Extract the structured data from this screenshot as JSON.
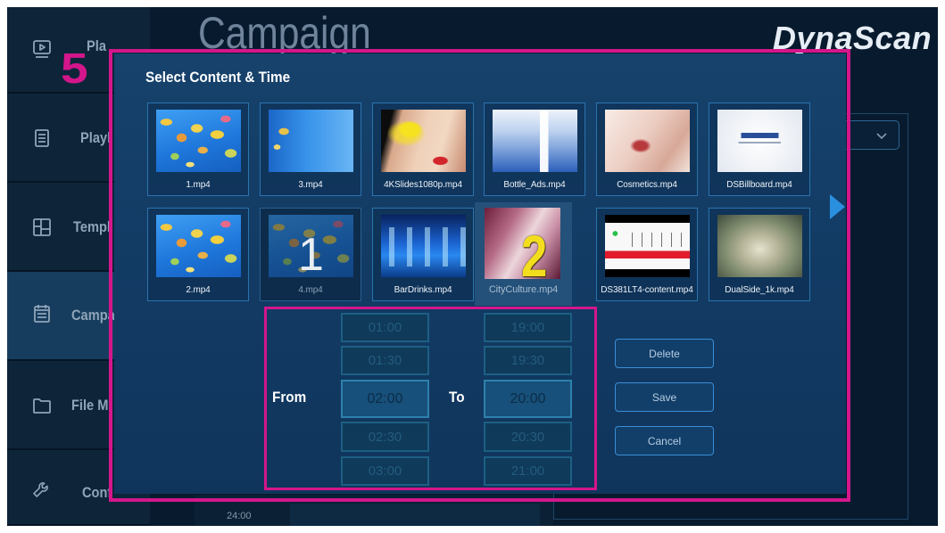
{
  "app": {
    "brand": "DynaScan",
    "page_title": "Campaign"
  },
  "sidebar": {
    "items": [
      {
        "label": "Pla",
        "icon": "play-screen-icon"
      },
      {
        "label": "Playl",
        "icon": "playlist-icon"
      },
      {
        "label": "Templ",
        "icon": "template-icon"
      },
      {
        "label": "Campa",
        "icon": "campaign-icon",
        "active": true
      },
      {
        "label": "File M",
        "icon": "folder-icon"
      },
      {
        "label": "Conf",
        "icon": "wrench-icon"
      }
    ]
  },
  "dialog": {
    "title": "Select Content & Time",
    "content": [
      {
        "name": "1.mp4"
      },
      {
        "name": "3.mp4"
      },
      {
        "name": "4KSlides1080p.mp4"
      },
      {
        "name": "Bottle_Ads.mp4"
      },
      {
        "name": "Cosmetics.mp4"
      },
      {
        "name": "DSBillboard.mp4"
      },
      {
        "name": "2.mp4"
      },
      {
        "name": "4.mp4",
        "dimmed": true
      },
      {
        "name": "BarDrinks.mp4"
      },
      {
        "name": "CityCulture.mp4",
        "highlighted": true
      },
      {
        "name": "DS381LT4-content.mp4"
      },
      {
        "name": "DualSide_1k.mp4"
      }
    ],
    "next_icon": "chevron-right-icon",
    "time_range": {
      "from_label": "From",
      "to_label": "To",
      "from_options": [
        "01:00",
        "01:30",
        "02:00",
        "02:30",
        "03:00"
      ],
      "from_selected_index": 2,
      "to_options": [
        "19:00",
        "19:30",
        "20:00",
        "20:30",
        "21:00"
      ],
      "to_selected_index": 2
    },
    "buttons": {
      "delete": "Delete",
      "save": "Save",
      "cancel": "Cancel"
    }
  },
  "background": {
    "dropdown_icon": "chevron-down-icon",
    "timeline_end_label": "24:00"
  },
  "annotations": {
    "step_marker": "5",
    "content_marker_1": "1",
    "content_marker_2": "2"
  },
  "colors": {
    "annotation": "#d4168b",
    "accent": "#2b8fe0",
    "background": "#081b2e",
    "dialog": "#123a63",
    "marker_2": "#f3de1e"
  }
}
